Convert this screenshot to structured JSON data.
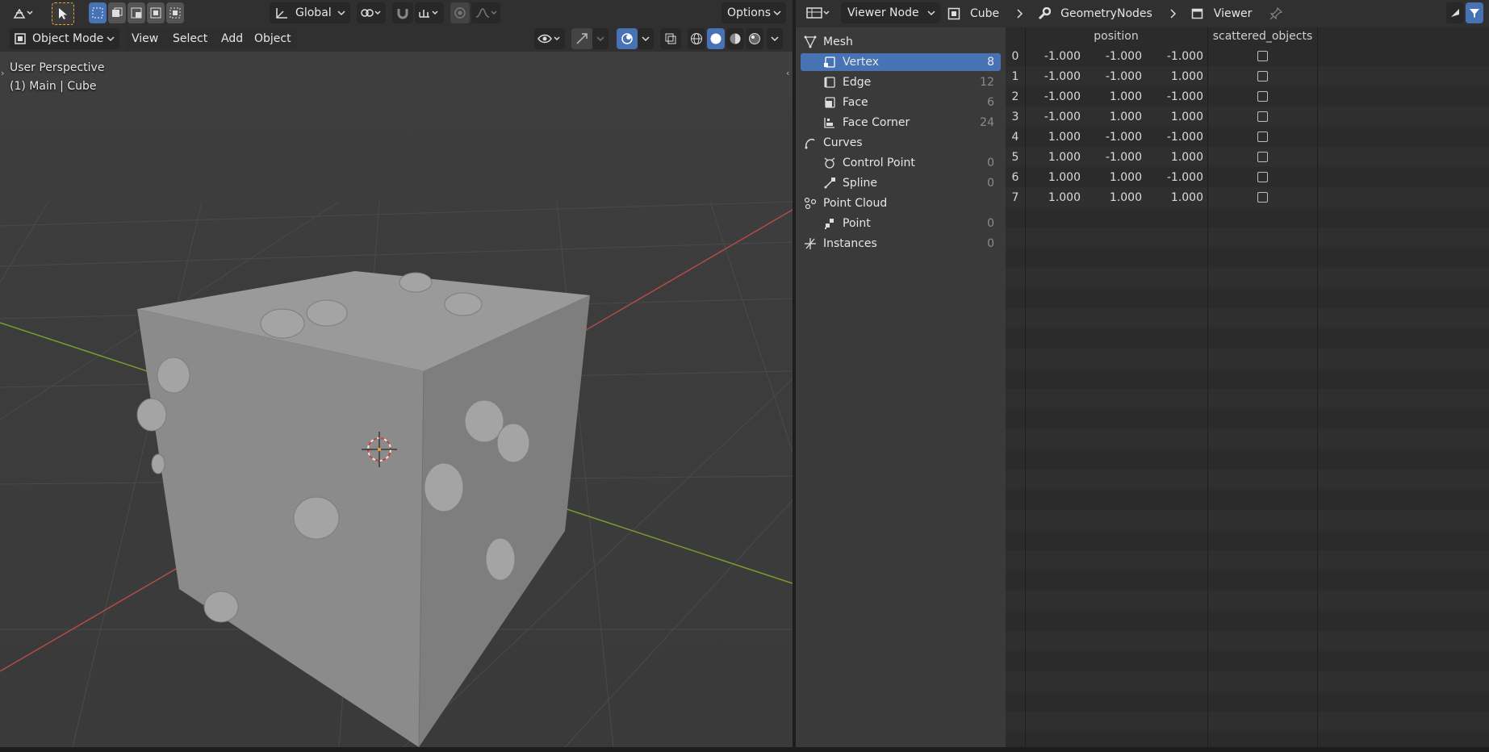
{
  "viewport": {
    "header": {
      "transform_orientation": "Global",
      "options_label": "Options",
      "mode_label": "Object Mode",
      "menus": [
        "View",
        "Select",
        "Add",
        "Object"
      ]
    },
    "overlay": {
      "perspective_label": "User Perspective",
      "object_label": "(1) Main | Cube"
    }
  },
  "spreadsheet": {
    "header": {
      "viewer_dropdown": "Viewer Node",
      "breadcrumb": [
        "Cube",
        "GeometryNodes",
        "Viewer"
      ]
    },
    "tree": [
      {
        "label": "Mesh",
        "count": "",
        "level": 0,
        "icon": "mesh-icon"
      },
      {
        "label": "Vertex",
        "count": "8",
        "level": 1,
        "icon": "vertex-icon",
        "selected": true
      },
      {
        "label": "Edge",
        "count": "12",
        "level": 1,
        "icon": "edge-icon"
      },
      {
        "label": "Face",
        "count": "6",
        "level": 1,
        "icon": "face-icon"
      },
      {
        "label": "Face Corner",
        "count": "24",
        "level": 1,
        "icon": "face-corner-icon"
      },
      {
        "label": "Curves",
        "count": "",
        "level": 0,
        "icon": "curves-icon"
      },
      {
        "label": "Control Point",
        "count": "0",
        "level": 1,
        "icon": "control-point-icon"
      },
      {
        "label": "Spline",
        "count": "0",
        "level": 1,
        "icon": "spline-icon"
      },
      {
        "label": "Point Cloud",
        "count": "",
        "level": 0,
        "icon": "point-cloud-icon"
      },
      {
        "label": "Point",
        "count": "0",
        "level": 1,
        "icon": "point-icon"
      },
      {
        "label": "Instances",
        "count": "0",
        "level": 0,
        "icon": "instances-icon"
      }
    ],
    "columns": [
      "position",
      "scattered_objects"
    ],
    "rows": [
      {
        "index": "0",
        "position": [
          "-1.000",
          "-1.000",
          "-1.000"
        ],
        "scattered": false
      },
      {
        "index": "1",
        "position": [
          "-1.000",
          "-1.000",
          "1.000"
        ],
        "scattered": false
      },
      {
        "index": "2",
        "position": [
          "-1.000",
          "1.000",
          "-1.000"
        ],
        "scattered": false
      },
      {
        "index": "3",
        "position": [
          "-1.000",
          "1.000",
          "1.000"
        ],
        "scattered": false
      },
      {
        "index": "4",
        "position": [
          "1.000",
          "-1.000",
          "-1.000"
        ],
        "scattered": false
      },
      {
        "index": "5",
        "position": [
          "1.000",
          "-1.000",
          "1.000"
        ],
        "scattered": false
      },
      {
        "index": "6",
        "position": [
          "1.000",
          "1.000",
          "-1.000"
        ],
        "scattered": false
      },
      {
        "index": "7",
        "position": [
          "1.000",
          "1.000",
          "1.000"
        ],
        "scattered": false
      }
    ]
  },
  "colors": {
    "accent": "#4772b3",
    "x_axis": "#b44a4a",
    "y_axis": "#7a9e2a"
  }
}
